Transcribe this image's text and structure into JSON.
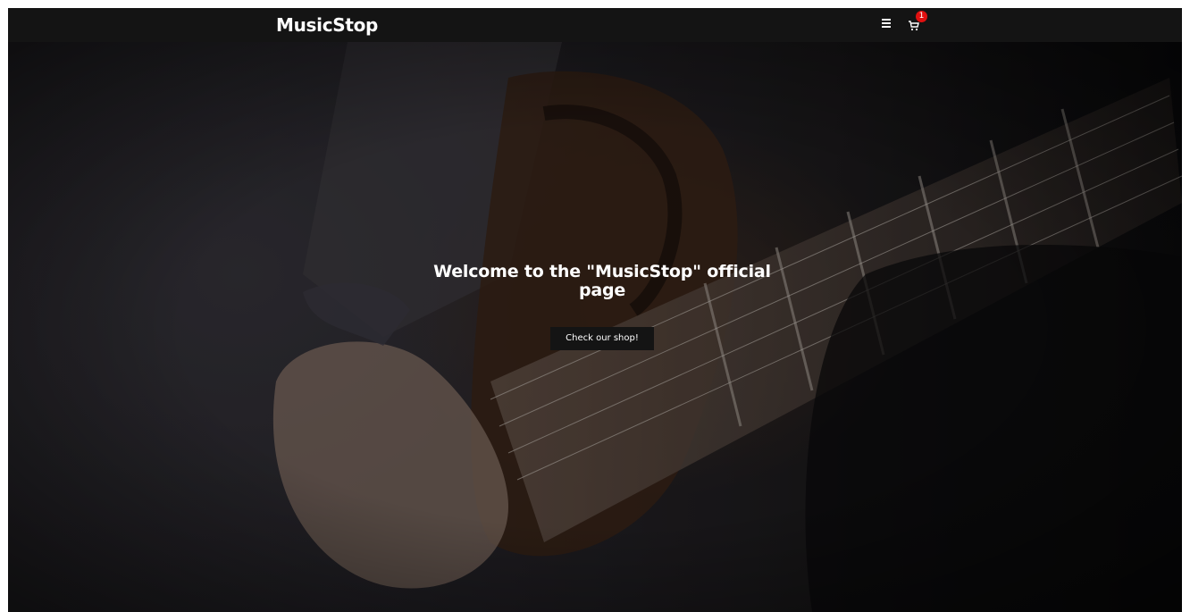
{
  "navbar": {
    "brand": "MusicStop",
    "menu_icon": "hamburger-menu-icon",
    "cart_icon": "shopping-cart-icon",
    "cart_count": "1",
    "badge_color": "#e01010"
  },
  "hero": {
    "title": "Welcome to the \"MusicStop\" official page",
    "cta_label": "Check our shop!",
    "background_image": "guitar-player-photo"
  }
}
